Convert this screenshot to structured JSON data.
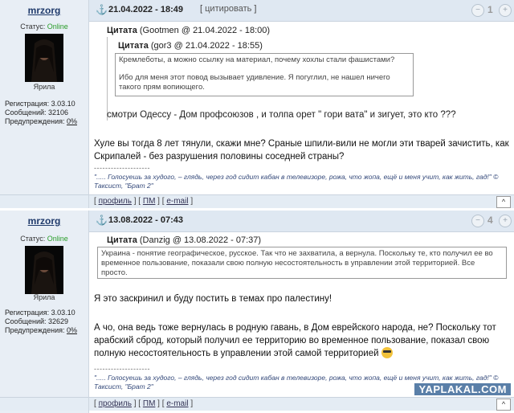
{
  "post1": {
    "username": "mrzorg",
    "status_label": "Статус:",
    "status_value": "Online",
    "rank": "Ярила",
    "reg_label": "Регистрация:",
    "reg_value": "3.03.10",
    "msgs_label": "Сообщений:",
    "msgs_value": "32106",
    "warn_label": "Предупреждения:",
    "warn_value": "0%",
    "date": "21.04.2022 - 18:49",
    "quote_button": "цитировать",
    "rating": "1",
    "quote_outer_label": "Цитата",
    "quote_outer_meta": "(Gootmen @ 21.04.2022 - 18:00)",
    "quote_inner_label": "Цитата",
    "quote_inner_meta": "(gor3 @ 21.04.2022 - 18:55)",
    "quote_inner_text1": "Кремлеботы, а можно ссылку на материал, почему хохлы стали фашистами?",
    "quote_inner_text2": "Ибо для меня этот повод вызывает удивление. Я погуглил, не нашел ничего такого прям вопиющего.",
    "quote_outer_text": "смотри Одессу - Дом профсоюзов , и толпа орет \" гори вата\" и зигует, это кто ???",
    "message": "Хуле вы тогда 8 лет тянули, скажи мне? Сраные шпили-вили не могли эти тварей зачистить, как Скрипалей - без разрушения половины соседней страны?",
    "separator": "--------------------",
    "signature": "\"..... Голосуешь за худого, – глядь, через год сидит кабан в телевизоре, рожа, что жопа, ещё и меня учит, как жить, гад!\" © Таксист, \"Брат 2\"",
    "profile_link": "профиль",
    "pm_link": "ПМ",
    "email_link": "e-mail",
    "up_button": "^"
  },
  "post2": {
    "username": "mrzorg",
    "status_label": "Статус:",
    "status_value": "Online",
    "rank": "Ярила",
    "reg_label": "Регистрация:",
    "reg_value": "3.03.10",
    "msgs_label": "Сообщений:",
    "msgs_value": "32629",
    "warn_label": "Предупреждения:",
    "warn_value": "0%",
    "date": "13.08.2022 - 07:43",
    "rating": "4",
    "quote_label": "Цитата",
    "quote_meta": "(Danzig @ 13.08.2022 - 07:37)",
    "quote_text": "Украина - понятие географическое, русское. Так что не захватила, а вернула. Поскольку те, кто получил ее во временное пользование, показали свою полную несостоятельность в управлении этой территорией. Все просто.",
    "message1": "Я это заскринил и буду постить в темах про палестину!",
    "message2": "А чо, она ведь тоже вернулась в родную гавань, в Дом еврейского народа, не? Поскольку тот арабский сброд, который получил ее территорию во временное пользование, показал свою полную несостоятельность в управлении этой самой территорией",
    "separator": "--------------------",
    "signature": "\"..... Голосуешь за худого, – глядь, через год сидит кабан в телевизоре, рожа, что жопа, ещё и меня учит, как жить, гад!\" © Таксист, \"Брат 2\"",
    "profile_link": "профиль",
    "pm_link": "ПМ",
    "email_link": "e-mail",
    "up_button": "^"
  },
  "watermark": "YAPLAKAL.COM",
  "icons": {
    "anchor": "anchor-icon",
    "minus": "minus-icon",
    "plus": "plus-icon",
    "emoji": "cool-emoji-icon"
  }
}
